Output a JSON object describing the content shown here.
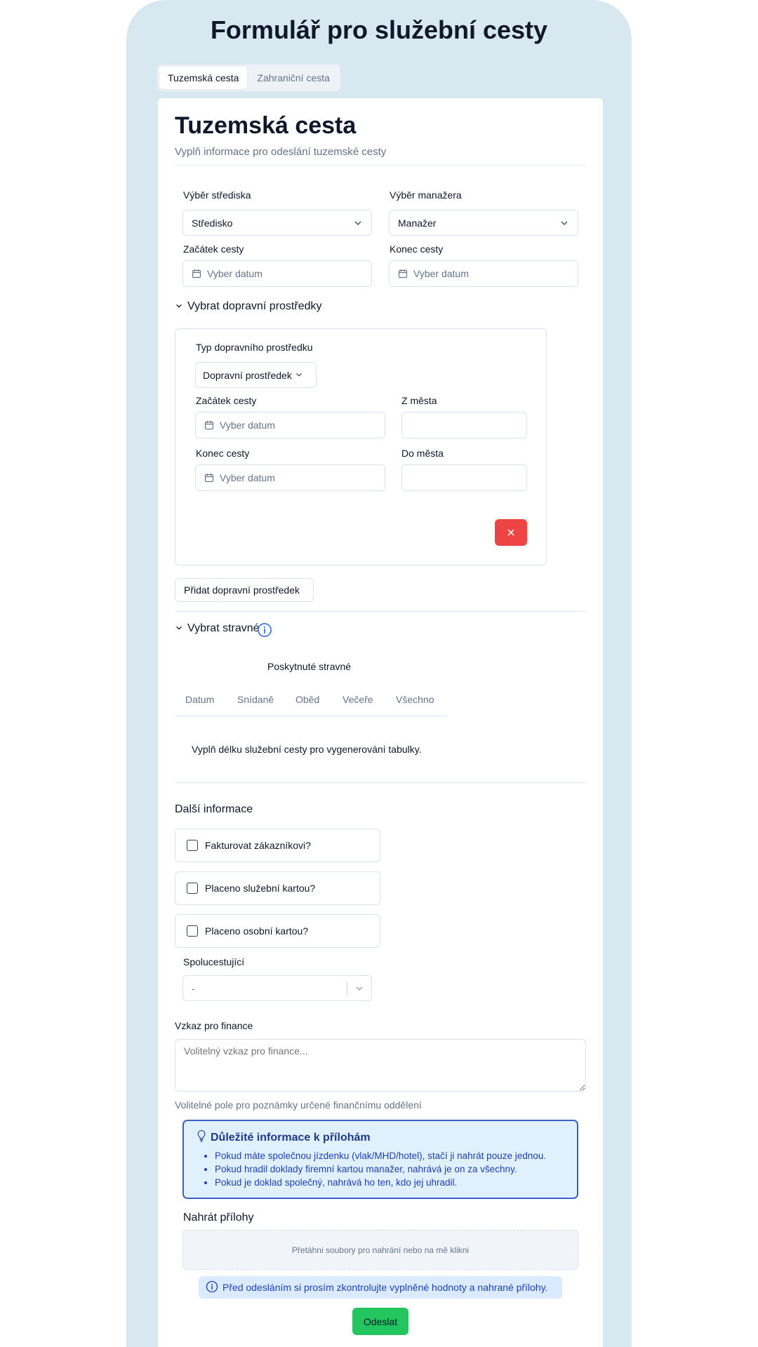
{
  "page": {
    "title": "Formulář pro služební cesty"
  },
  "tabs": [
    {
      "label": "Tuzemská cesta",
      "active": true
    },
    {
      "label": "Zahraniční cesta",
      "active": false
    }
  ],
  "card": {
    "title": "Tuzemská cesta",
    "subtitle": "Vyplň informace pro odeslání tuzemské cesty"
  },
  "basic": {
    "center_label": "Výběr střediska",
    "center_value": "Středisko",
    "manager_label": "Výběr manažera",
    "manager_value": "Manažer",
    "start_label": "Začátek cesty",
    "start_placeholder": "Vyber datum",
    "end_label": "Konec cesty",
    "end_placeholder": "Vyber datum"
  },
  "transport": {
    "heading": "Vybrat dopravní prostředky",
    "type_label": "Typ dopravního prostředku",
    "type_value": "Dopravní prostředek",
    "start_label": "Začátek cesty",
    "start_placeholder": "Vyber datum",
    "from_label": "Z města",
    "from_value": "",
    "end_label": "Konec cesty",
    "end_placeholder": "Vyber datum",
    "to_label": "Do města",
    "to_value": "",
    "delete_icon": "x-icon",
    "add_label": "Přidat dopravní prostředek"
  },
  "meals": {
    "heading": "Vybrat stravné",
    "group_header": "Poskytnuté stravné",
    "columns": [
      "Datum",
      "Snídaně",
      "Oběd",
      "Večeře",
      "Všechno"
    ],
    "empty_text": "Vyplň délku služební cesty pro vygenerování tabulky."
  },
  "extra": {
    "heading": "Další informace",
    "checkboxes": [
      {
        "label": "Fakturovat zákazníkovi?",
        "checked": false
      },
      {
        "label": "Placeno služební kartou?",
        "checked": false
      },
      {
        "label": "Placeno osobní kartou?",
        "checked": false
      }
    ],
    "companions_label": "Spolucestující",
    "companions_value": "-",
    "finance_label": "Vzkaz pro finance",
    "finance_placeholder": "Volitelný vzkaz pro finance...",
    "finance_hint": "Volitelné pole pro poznámky určené finančnímu oddělení"
  },
  "attachments_info": {
    "title": "Důležité informace k přílohám",
    "items": [
      "Pokud máte společnou jízdenku (vlak/MHD/hotel), stačí ji nahrát pouze jednou.",
      "Pokud hradil doklady firemní kartou manažer, nahrává je on za všechny.",
      "Pokud je doklad společný, nahrává ho ten, kdo jej uhradil."
    ]
  },
  "upload": {
    "label": "Nahrát přílohy",
    "dropzone_text": "Přetáhni soubory pro nahrání nebo na mě klikni"
  },
  "notice": {
    "text": "Před odesláním si prosím zkontrolujte vyplněné hodnoty a nahrané přílohy."
  },
  "submit": {
    "label": "Odeslat"
  },
  "colors": {
    "background": "#d8e8f0",
    "danger": "#ef4444",
    "submit": "#22c55e",
    "info_border": "#3b5fc9",
    "info_bg": "#e0f0fc"
  }
}
